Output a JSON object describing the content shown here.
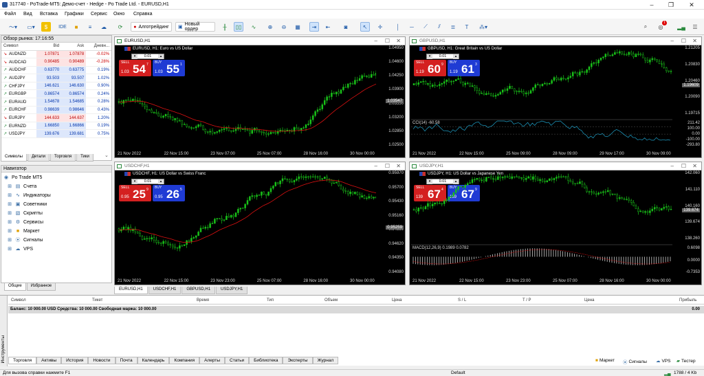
{
  "window": {
    "title": "317740 - PoTrade-MT5: Демо-счет - Hedge - Po Trade Ltd. - EURUSD,H1"
  },
  "menu": [
    "Файл",
    "Вид",
    "Вставка",
    "Графики",
    "Сервис",
    "Окно",
    "Справка"
  ],
  "toolbar": {
    "algo_label": "Алготрейдинг",
    "new_order_label": "Новый ордер",
    "ide_label": "IDE",
    "badge": "1"
  },
  "market_watch": {
    "title": "Обзор рынка: 17:16:55",
    "columns": [
      "Символ",
      "Bid",
      "Ask",
      "Дневн..."
    ],
    "rows": [
      {
        "symbol": "AUDNZD",
        "bid": "1.07871",
        "ask": "1.07878",
        "change": "-0.02%",
        "dir": "down"
      },
      {
        "symbol": "AUDCAD",
        "bid": "0.90485",
        "ask": "0.90489",
        "change": "-0.28%",
        "dir": "down"
      },
      {
        "symbol": "AUDCHF",
        "bid": "0.63770",
        "ask": "0.63775",
        "change": "0.19%",
        "dir": "up"
      },
      {
        "symbol": "AUDJPY",
        "bid": "93.503",
        "ask": "93.507",
        "change": "1.02%",
        "dir": "up"
      },
      {
        "symbol": "CHFJPY",
        "bid": "146.621",
        "ask": "146.630",
        "change": "0.90%",
        "dir": "up"
      },
      {
        "symbol": "EURGBP",
        "bid": "0.86574",
        "ask": "0.86574",
        "change": "0.24%",
        "dir": "up"
      },
      {
        "symbol": "EURAUD",
        "bid": "1.54678",
        "ask": "1.54685",
        "change": "0.28%",
        "dir": "up"
      },
      {
        "symbol": "EURCHF",
        "bid": "0.98639",
        "ask": "0.98646",
        "change": "0.43%",
        "dir": "up"
      },
      {
        "symbol": "EURJPY",
        "bid": "144.633",
        "ask": "144.637",
        "change": "1.20%",
        "dir": "down"
      },
      {
        "symbol": "EURNZD",
        "bid": "1.66850",
        "ask": "1.66866",
        "change": "0.19%",
        "dir": "up"
      },
      {
        "symbol": "USDJPY",
        "bid": "139.676",
        "ask": "139.681",
        "change": "0.75%",
        "dir": "up"
      }
    ],
    "tabs": [
      "Символы",
      "Детали",
      "Торговля",
      "Тики"
    ]
  },
  "navigator": {
    "title": "Навигатор",
    "root": "Po Trade MT5",
    "items": [
      "Счета",
      "Индикаторы",
      "Советники",
      "Скрипты",
      "Сервисы",
      "Маркет",
      "Сигналы",
      "VPS"
    ],
    "tabs": [
      "Общие",
      "Избранное"
    ]
  },
  "charts": [
    {
      "tab": "EURUSD,H1",
      "caption": "EURUSD, H1:  Euro vs US Dollar",
      "sell_pre": "1.03",
      "sell_big": "54",
      "sell_sup": "7",
      "buy_pre": "1.03",
      "buy_big": "55",
      "buy_sup": "1",
      "lot": "0.01",
      "yticks": [
        "1.04950",
        "1.04600",
        "1.04250",
        "1.03900",
        "1.03550",
        "1.03200",
        "1.02850",
        "1.02500"
      ],
      "price": "1.03547",
      "xticks": [
        "21 Nov 2022",
        "22 Nov 15:00",
        "23 Nov 07:00",
        "25 Nov 07:00",
        "28 Nov 16:00",
        "30 Nov 00:00"
      ]
    },
    {
      "tab": "GBPUSD,H1",
      "caption": "GBPUSD, H1:  Great Britain vs US Dollar",
      "sell_pre": "1.19",
      "sell_big": "60",
      "sell_sup": "9",
      "buy_pre": "1.19",
      "buy_big": "61",
      "buy_sup": "3",
      "lot": "0.01",
      "yticks": [
        "1.21205",
        "1.20830",
        "1.20460",
        "1.20090",
        "1.19715"
      ],
      "price": "1.19609",
      "osc": "CCI(14) -60.58",
      "osc_ticks": [
        "211.42",
        "100.00",
        "0.00",
        "-100.00",
        "-293.80"
      ],
      "xticks": [
        "21 Nov 2022",
        "22 Nov 15:00",
        "25 Nov 09:00",
        "28 Nov 09:00",
        "29 Nov 17:00",
        "30 Nov 09:00"
      ]
    },
    {
      "tab": "USDCHF,H1",
      "caption": "USDCHF, H1:  US Dollar vs Swiss Franc",
      "sell_pre": "0.95",
      "sell_big": "25",
      "sell_sup": "9",
      "buy_pre": "0.95",
      "buy_big": "26",
      "buy_sup": "5",
      "lot": "0.01",
      "yticks": [
        "0.95970",
        "0.95700",
        "0.95430",
        "0.95160",
        "0.94890",
        "0.94620",
        "0.94350",
        "0.94080"
      ],
      "price": "0.95259",
      "xticks": [
        "21 Nov 2022",
        "22 Nov 15:00",
        "23 Nov 23:00",
        "25 Nov 07:00",
        "28 Nov 16:00",
        "30 Nov 00:00"
      ]
    },
    {
      "tab": "USDJPY,H1",
      "caption": "USDJPY, H1:  US Dollar vs Japanese Yen",
      "sell_pre": "139",
      "sell_big": "67",
      "sell_sup": "4",
      "buy_pre": "139",
      "buy_big": "67",
      "buy_sup": "9",
      "lot": "0.01",
      "yticks": [
        "142.060",
        "141.110",
        "140.160",
        "139.674",
        "138.260"
      ],
      "price": "139.674",
      "osc": "MACD(12,26,9) 0.1989 0.0782",
      "osc_ticks": [
        "0.6098",
        "0.0000",
        "-0.7353"
      ],
      "xticks": [
        "21 Nov 2022",
        "22 Nov 15:00",
        "23 Nov 23:00",
        "25 Nov 07:00",
        "28 Nov 16:00",
        "30 Nov 00:00"
      ]
    }
  ],
  "chart_common": {
    "sell_label": "SELL",
    "buy_label": "BUY"
  },
  "terminal": {
    "columns": [
      "Символ",
      "Тикет",
      "Время",
      "Тип",
      "Объем",
      "Цена",
      "S / L",
      "T / P",
      "Цена",
      "Прибыль"
    ],
    "balance": "Баланс: 10 000.00 USD  Средства: 10 000.00  Свободная маржа: 10 000.00",
    "balance_value": "0.00",
    "side_label": "Инструменты",
    "tabs": [
      "Торговля",
      "Активы",
      "История",
      "Новости",
      "Почта",
      "Календарь",
      "Компания",
      "Алерты",
      "Статьи",
      "Библиотека",
      "Эксперты",
      "Журнал"
    ],
    "right": [
      "Маркет",
      "Сигналы",
      "VPS",
      "Тестер"
    ]
  },
  "status": {
    "help": "Для вызова справки нажмите F1",
    "profile": "Default",
    "traffic": "1788 / 4 Kb"
  }
}
